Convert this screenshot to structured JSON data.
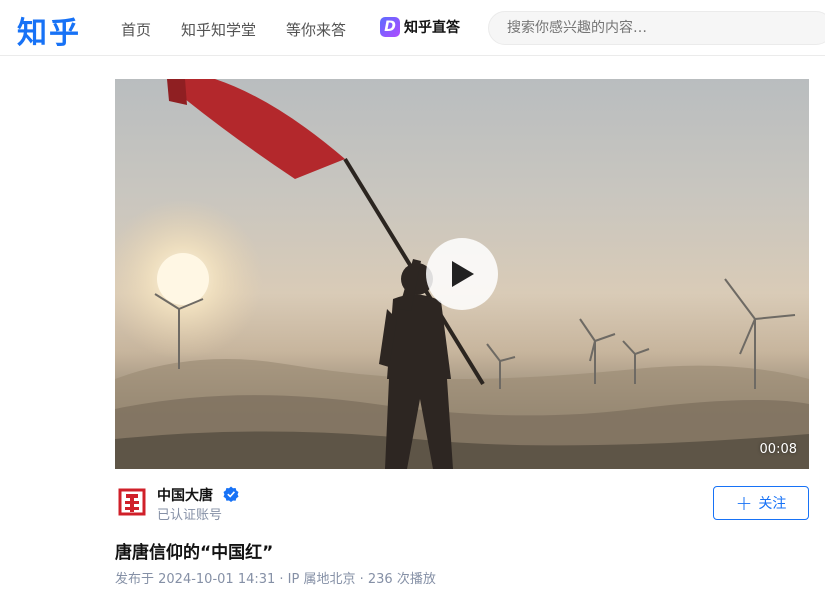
{
  "header": {
    "logo": "知乎",
    "nav": [
      "首页",
      "知乎知学堂",
      "等你来答"
    ],
    "zhida_label": "知乎直答",
    "search_placeholder": "搜索你感兴趣的内容…"
  },
  "video": {
    "duration": "00:08"
  },
  "author": {
    "name": "中国大唐",
    "subtitle": "已认证账号",
    "follow_label": "关注",
    "verified_icon": "verified-badge-icon"
  },
  "post": {
    "title": "唐唐信仰的“中国红”",
    "meta": "发布于 2024-10-01 14:31 · IP 属地北京 · 236 次播放"
  },
  "colors": {
    "brand": "#1772f6",
    "muted": "#8590a6"
  }
}
